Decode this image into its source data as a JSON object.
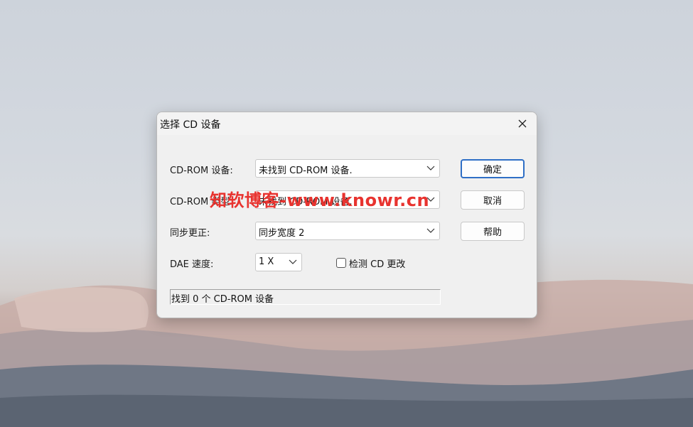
{
  "dialog": {
    "title": "选择 CD 设备",
    "close_icon": "close-icon"
  },
  "fields": {
    "cdrom_device": {
      "label": "CD-ROM 设备:",
      "value": "未找到 CD-ROM 设备."
    },
    "cdrom_type": {
      "label": "CD-ROM 类型",
      "value": "未找到 CD-ROM 设备."
    },
    "sync_correction": {
      "label": "同步更正:",
      "value": "同步宽度 2"
    },
    "dae_speed": {
      "label": "DAE 速度:",
      "value": "1 X"
    }
  },
  "checkbox": {
    "label": "检测 CD 更改",
    "checked": false
  },
  "buttons": {
    "ok": "确定",
    "cancel": "取消",
    "help": "帮助"
  },
  "status": "找到 0 个 CD-ROM 设备",
  "watermark": "知软博客-www.knowr.cn",
  "colors": {
    "watermark": "#e8332f",
    "default_button_border": "#2f6fc6"
  }
}
